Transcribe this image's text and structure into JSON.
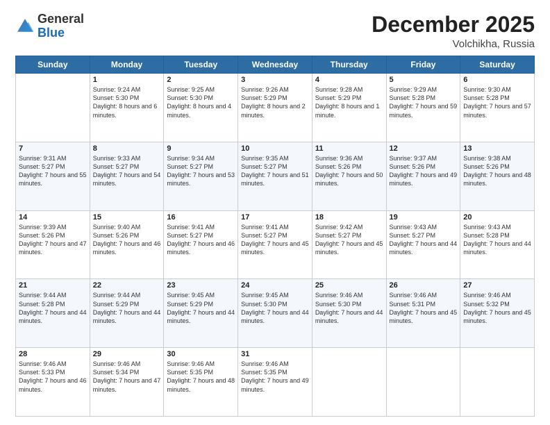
{
  "logo": {
    "general": "General",
    "blue": "Blue"
  },
  "header": {
    "month": "December 2025",
    "location": "Volchikha, Russia"
  },
  "days_of_week": [
    "Sunday",
    "Monday",
    "Tuesday",
    "Wednesday",
    "Thursday",
    "Friday",
    "Saturday"
  ],
  "weeks": [
    [
      {
        "day": "",
        "sunrise": "",
        "sunset": "",
        "daylight": ""
      },
      {
        "day": "1",
        "sunrise": "Sunrise: 9:24 AM",
        "sunset": "Sunset: 5:30 PM",
        "daylight": "Daylight: 8 hours and 6 minutes."
      },
      {
        "day": "2",
        "sunrise": "Sunrise: 9:25 AM",
        "sunset": "Sunset: 5:30 PM",
        "daylight": "Daylight: 8 hours and 4 minutes."
      },
      {
        "day": "3",
        "sunrise": "Sunrise: 9:26 AM",
        "sunset": "Sunset: 5:29 PM",
        "daylight": "Daylight: 8 hours and 2 minutes."
      },
      {
        "day": "4",
        "sunrise": "Sunrise: 9:28 AM",
        "sunset": "Sunset: 5:29 PM",
        "daylight": "Daylight: 8 hours and 1 minute."
      },
      {
        "day": "5",
        "sunrise": "Sunrise: 9:29 AM",
        "sunset": "Sunset: 5:28 PM",
        "daylight": "Daylight: 7 hours and 59 minutes."
      },
      {
        "day": "6",
        "sunrise": "Sunrise: 9:30 AM",
        "sunset": "Sunset: 5:28 PM",
        "daylight": "Daylight: 7 hours and 57 minutes."
      }
    ],
    [
      {
        "day": "7",
        "sunrise": "Sunrise: 9:31 AM",
        "sunset": "Sunset: 5:27 PM",
        "daylight": "Daylight: 7 hours and 55 minutes."
      },
      {
        "day": "8",
        "sunrise": "Sunrise: 9:33 AM",
        "sunset": "Sunset: 5:27 PM",
        "daylight": "Daylight: 7 hours and 54 minutes."
      },
      {
        "day": "9",
        "sunrise": "Sunrise: 9:34 AM",
        "sunset": "Sunset: 5:27 PM",
        "daylight": "Daylight: 7 hours and 53 minutes."
      },
      {
        "day": "10",
        "sunrise": "Sunrise: 9:35 AM",
        "sunset": "Sunset: 5:27 PM",
        "daylight": "Daylight: 7 hours and 51 minutes."
      },
      {
        "day": "11",
        "sunrise": "Sunrise: 9:36 AM",
        "sunset": "Sunset: 5:26 PM",
        "daylight": "Daylight: 7 hours and 50 minutes."
      },
      {
        "day": "12",
        "sunrise": "Sunrise: 9:37 AM",
        "sunset": "Sunset: 5:26 PM",
        "daylight": "Daylight: 7 hours and 49 minutes."
      },
      {
        "day": "13",
        "sunrise": "Sunrise: 9:38 AM",
        "sunset": "Sunset: 5:26 PM",
        "daylight": "Daylight: 7 hours and 48 minutes."
      }
    ],
    [
      {
        "day": "14",
        "sunrise": "Sunrise: 9:39 AM",
        "sunset": "Sunset: 5:26 PM",
        "daylight": "Daylight: 7 hours and 47 minutes."
      },
      {
        "day": "15",
        "sunrise": "Sunrise: 9:40 AM",
        "sunset": "Sunset: 5:26 PM",
        "daylight": "Daylight: 7 hours and 46 minutes."
      },
      {
        "day": "16",
        "sunrise": "Sunrise: 9:41 AM",
        "sunset": "Sunset: 5:27 PM",
        "daylight": "Daylight: 7 hours and 46 minutes."
      },
      {
        "day": "17",
        "sunrise": "Sunrise: 9:41 AM",
        "sunset": "Sunset: 5:27 PM",
        "daylight": "Daylight: 7 hours and 45 minutes."
      },
      {
        "day": "18",
        "sunrise": "Sunrise: 9:42 AM",
        "sunset": "Sunset: 5:27 PM",
        "daylight": "Daylight: 7 hours and 45 minutes."
      },
      {
        "day": "19",
        "sunrise": "Sunrise: 9:43 AM",
        "sunset": "Sunset: 5:27 PM",
        "daylight": "Daylight: 7 hours and 44 minutes."
      },
      {
        "day": "20",
        "sunrise": "Sunrise: 9:43 AM",
        "sunset": "Sunset: 5:28 PM",
        "daylight": "Daylight: 7 hours and 44 minutes."
      }
    ],
    [
      {
        "day": "21",
        "sunrise": "Sunrise: 9:44 AM",
        "sunset": "Sunset: 5:28 PM",
        "daylight": "Daylight: 7 hours and 44 minutes."
      },
      {
        "day": "22",
        "sunrise": "Sunrise: 9:44 AM",
        "sunset": "Sunset: 5:29 PM",
        "daylight": "Daylight: 7 hours and 44 minutes."
      },
      {
        "day": "23",
        "sunrise": "Sunrise: 9:45 AM",
        "sunset": "Sunset: 5:29 PM",
        "daylight": "Daylight: 7 hours and 44 minutes."
      },
      {
        "day": "24",
        "sunrise": "Sunrise: 9:45 AM",
        "sunset": "Sunset: 5:30 PM",
        "daylight": "Daylight: 7 hours and 44 minutes."
      },
      {
        "day": "25",
        "sunrise": "Sunrise: 9:46 AM",
        "sunset": "Sunset: 5:30 PM",
        "daylight": "Daylight: 7 hours and 44 minutes."
      },
      {
        "day": "26",
        "sunrise": "Sunrise: 9:46 AM",
        "sunset": "Sunset: 5:31 PM",
        "daylight": "Daylight: 7 hours and 45 minutes."
      },
      {
        "day": "27",
        "sunrise": "Sunrise: 9:46 AM",
        "sunset": "Sunset: 5:32 PM",
        "daylight": "Daylight: 7 hours and 45 minutes."
      }
    ],
    [
      {
        "day": "28",
        "sunrise": "Sunrise: 9:46 AM",
        "sunset": "Sunset: 5:33 PM",
        "daylight": "Daylight: 7 hours and 46 minutes."
      },
      {
        "day": "29",
        "sunrise": "Sunrise: 9:46 AM",
        "sunset": "Sunset: 5:34 PM",
        "daylight": "Daylight: 7 hours and 47 minutes."
      },
      {
        "day": "30",
        "sunrise": "Sunrise: 9:46 AM",
        "sunset": "Sunset: 5:35 PM",
        "daylight": "Daylight: 7 hours and 48 minutes."
      },
      {
        "day": "31",
        "sunrise": "Sunrise: 9:46 AM",
        "sunset": "Sunset: 5:35 PM",
        "daylight": "Daylight: 7 hours and 49 minutes."
      },
      {
        "day": "",
        "sunrise": "",
        "sunset": "",
        "daylight": ""
      },
      {
        "day": "",
        "sunrise": "",
        "sunset": "",
        "daylight": ""
      },
      {
        "day": "",
        "sunrise": "",
        "sunset": "",
        "daylight": ""
      }
    ]
  ]
}
